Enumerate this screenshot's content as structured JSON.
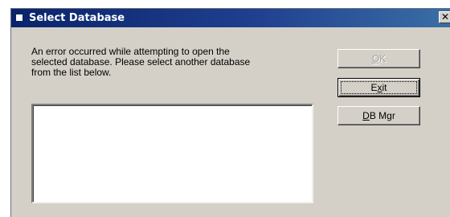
{
  "window": {
    "title": "Select Database",
    "close_glyph": "✕"
  },
  "message": {
    "line1": "An error occurred while attempting to open the",
    "line2": "selected database. Please select another database",
    "line3": "from the list below."
  },
  "database_list": {
    "items": []
  },
  "buttons": {
    "ok": {
      "label": "OK",
      "accel_char": "O",
      "rest": "K",
      "enabled": false
    },
    "exit": {
      "label": "Exit",
      "pre": "E",
      "accel_char": "x",
      "rest": "it",
      "enabled": true,
      "focused": true
    },
    "db_mgr": {
      "label": "DB Mgr",
      "accel_char": "D",
      "rest": "B Mgr",
      "enabled": true
    }
  },
  "colors": {
    "titlebar_start": "#0a246a",
    "titlebar_end": "#3a6ea5",
    "dialog_face": "#d4d0c8",
    "disabled_text": "#a0a0a0"
  },
  "icons": {
    "system_menu": "sysmenu-icon",
    "close": "close-icon"
  }
}
